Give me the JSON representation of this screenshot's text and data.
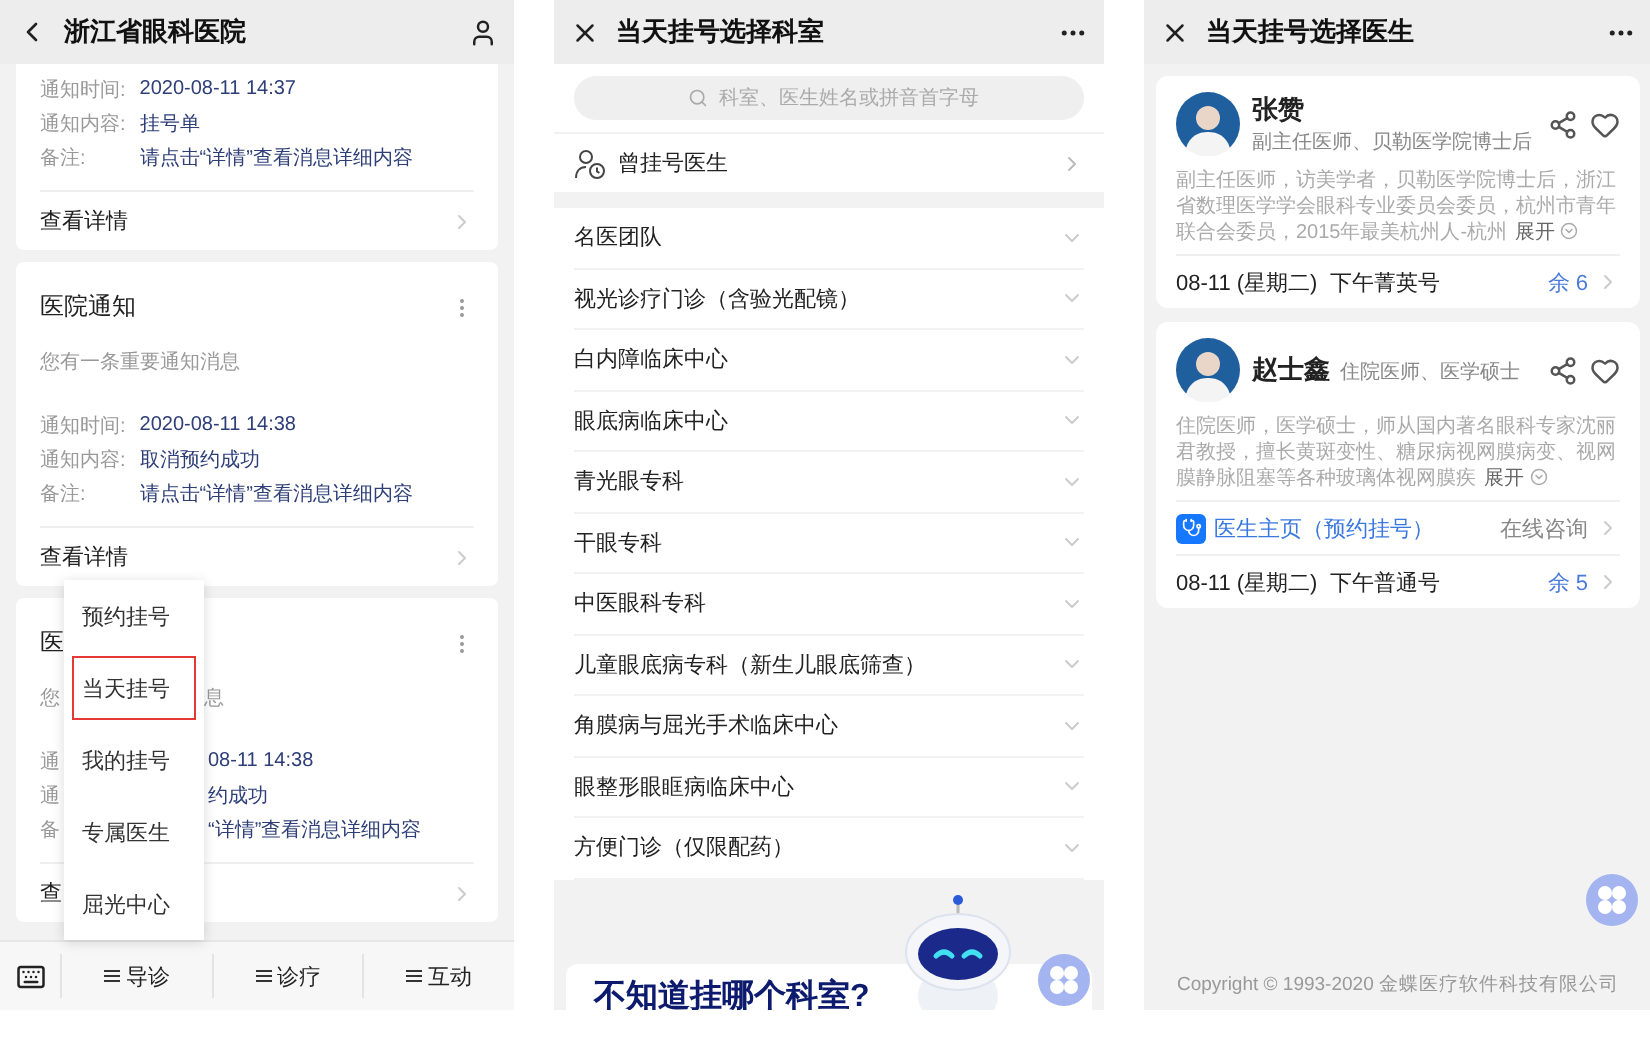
{
  "notice_screen": {
    "title": "浙江省眼科医院",
    "cards": [
      {
        "kind": "full",
        "fields": [
          {
            "label": "通知时间:",
            "value": "2020-08-11 14:37"
          },
          {
            "label": "通知内容:",
            "value": "挂号单"
          },
          {
            "label": "备注:",
            "value": "请点击“详情”查看消息详细内容"
          }
        ],
        "link": "查看详情"
      },
      {
        "kind": "full",
        "title": "医院通知",
        "description": "您有一条重要通知消息",
        "fields": [
          {
            "label": "通知时间:",
            "value": "2020-08-11 14:38"
          },
          {
            "label": "通知内容:",
            "value": "取消预约成功"
          },
          {
            "label": "备注:",
            "value": "请点击“详情”查看消息详细内容"
          }
        ],
        "link": "查看详情"
      },
      {
        "kind": "covered",
        "title": "医",
        "description": "您",
        "description_tail": "息",
        "fields": [
          {
            "label": "通",
            "value": "08-11 14:38"
          },
          {
            "label": "通",
            "value": "约成功"
          },
          {
            "label": "备",
            "value": "“详情”查看消息详细内容"
          }
        ],
        "link": "查"
      }
    ],
    "menu": [
      {
        "label": "预约挂号",
        "selected": false
      },
      {
        "label": "当天挂号",
        "selected": true
      },
      {
        "label": "我的挂号",
        "selected": false
      },
      {
        "label": "专属医生",
        "selected": false
      },
      {
        "label": "屈光中心",
        "selected": false
      }
    ],
    "tabs": [
      "导诊",
      "诊疗",
      "互动"
    ]
  },
  "department_screen": {
    "title": "当天挂号选择科室",
    "search": {
      "placeholder": "科室、医生姓名或拼音首字母"
    },
    "recent": "曾挂号医生",
    "departments": [
      "名医团队",
      "视光诊疗门诊（含验光配镜）",
      "白内障临床中心",
      "眼底病临床中心",
      "青光眼专科",
      "干眼专科",
      "中医眼科专科",
      "儿童眼底病专科（新生儿眼底筛查）",
      "角膜病与屈光手术临床中心",
      "眼整形眼眶病临床中心",
      "方便门诊（仅限配药）"
    ],
    "banner": "不知道挂哪个科室?"
  },
  "doctor_screen": {
    "title": "当天挂号选择医生",
    "doctors": [
      {
        "name": "张赞",
        "title": "副主任医师、贝勒医学院博士后",
        "description": "副主任医师，访美学者，贝勒医学院博士后，浙江省数理医学学会眼科专业委员会委员，杭州市青年联合会委员，2015年最美杭州人-杭州",
        "expand": "展开",
        "slot": "08-11 (星期二)  下午菁英号",
        "remaining": "余 6"
      },
      {
        "name": "赵士鑫",
        "title": "住院医师、医学硕士",
        "description": "住院医师，医学硕士，师从国内著名眼科专家沈丽君教授，擅长黄斑变性、糖尿病视网膜病变、视网膜静脉阻塞等各种玻璃体视网膜疾",
        "expand": "展开",
        "homepage": {
          "label": "医生主页（预约挂号）",
          "consult": "在线咨询"
        },
        "slot": "08-11 (星期二)  下午普通号",
        "remaining": "余 5"
      }
    ],
    "copyright": "Copyright © 1993-2020 金蝶医疗软件科技有限公司"
  }
}
